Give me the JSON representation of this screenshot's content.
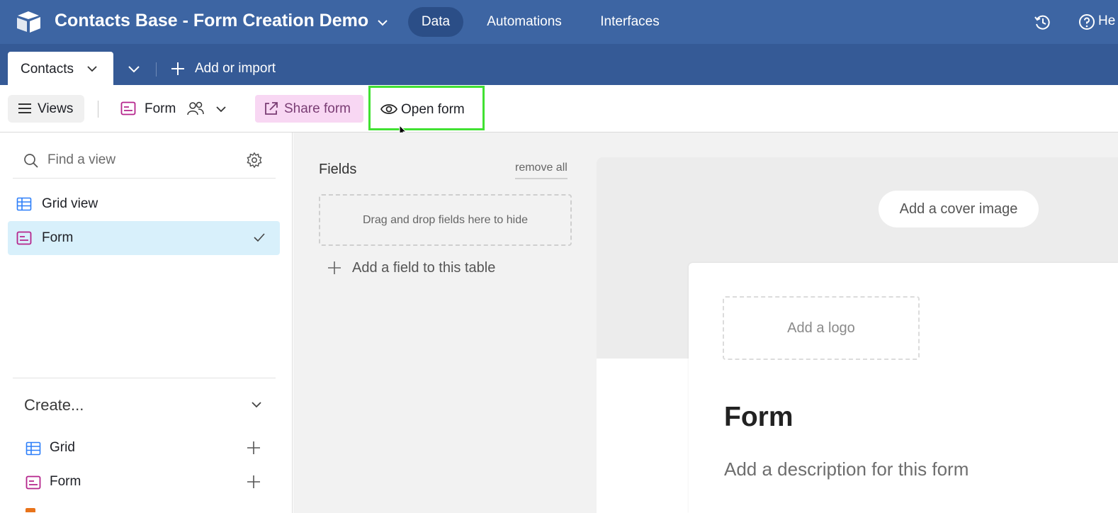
{
  "app": {
    "base_title": "Contacts Base - Form Creation Demo",
    "nav": [
      "Data",
      "Automations",
      "Interfaces"
    ],
    "active_nav": "Data",
    "help_label": "He"
  },
  "tabs": {
    "active_table": "Contacts",
    "add_or_import": "Add or import"
  },
  "viewbar": {
    "views_label": "Views",
    "current_view": "Form",
    "share_form": "Share form",
    "open_form": "Open form"
  },
  "sidebar": {
    "search_placeholder": "Find a view",
    "views": [
      {
        "label": "Grid view",
        "type": "grid"
      },
      {
        "label": "Form",
        "type": "form",
        "selected": true
      }
    ],
    "create_label": "Create...",
    "create_items": [
      {
        "label": "Grid",
        "type": "grid"
      },
      {
        "label": "Form",
        "type": "form"
      }
    ]
  },
  "form_builder": {
    "fields_title": "Fields",
    "remove_all": "remove all",
    "drop_hint": "Drag and drop fields here to hide",
    "add_field": "Add a field to this table",
    "add_cover": "Add a cover image",
    "add_logo": "Add a logo",
    "form_title": "Form",
    "form_description": "Add a description for this form"
  },
  "colors": {
    "topbar": "#3d65a3",
    "tabbar": "#355a96",
    "active_nav": "#2b4e87",
    "share_bg": "#f8d7f3",
    "highlight": "#41e132",
    "selected_view": "#d8f0fb",
    "grid_icon": "#2d7ff9",
    "form_icon": "#b5258c"
  },
  "icons": [
    "app-logo-icon",
    "chevron-down-icon",
    "history-icon",
    "help-icon",
    "plus-icon",
    "hamburger-icon",
    "form-icon",
    "collaborators-icon",
    "share-external-icon",
    "eye-icon",
    "search-icon",
    "gear-icon",
    "grid-icon",
    "check-icon",
    "mouse-cursor-icon"
  ]
}
